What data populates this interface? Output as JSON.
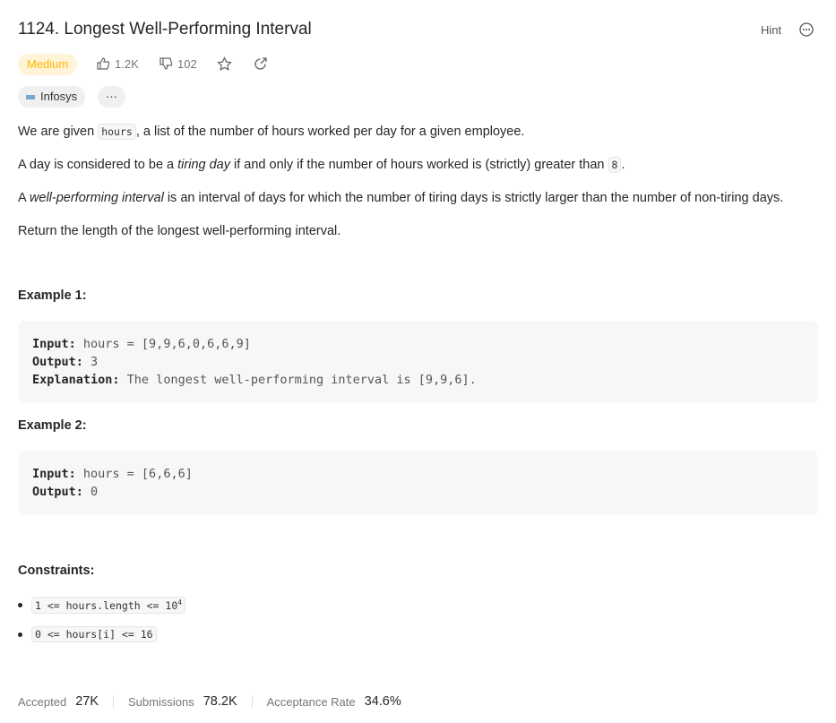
{
  "header": {
    "title": "1124. Longest Well-Performing Interval",
    "hint": "Hint"
  },
  "meta": {
    "difficulty": "Medium",
    "likes": "1.2K",
    "dislikes": "102",
    "company": "Infosys",
    "more": "···"
  },
  "desc": {
    "p1": [
      "We are given ",
      "hours",
      ", a list of the number of hours worked per day for a given employee."
    ],
    "p2": [
      "A day is considered to be a ",
      "tiring day",
      " if and only if the number of hours worked is (strictly) greater than ",
      "8",
      "."
    ],
    "p3": [
      "A ",
      "well-performing interval",
      " is an interval of days for which the number of tiring days is strictly larger than the number of non-tiring days."
    ],
    "p4": "Return the length of the longest well-performing interval."
  },
  "examples": [
    {
      "title": "Example 1:",
      "input_label": "Input:",
      "input": " hours = [9,9,6,0,6,6,9]",
      "output_label": "Output:",
      "output": " 3",
      "expl_label": "Explanation:",
      "expl": " The longest well-performing interval is [9,9,6]."
    },
    {
      "title": "Example 2:",
      "input_label": "Input:",
      "input": " hours = [6,6,6]",
      "output_label": "Output:",
      "output": " 0"
    }
  ],
  "constraints": {
    "title": "Constraints:",
    "c1": "1 <= hours.length <= 10",
    "c1_sup": "4",
    "c2": "0 <= hours[i] <= 16"
  },
  "footer": {
    "accepted_label": "Accepted",
    "accepted": "27K",
    "submissions_label": "Submissions",
    "submissions": "78.2K",
    "rate_label": "Acceptance Rate",
    "rate": "34.6%"
  }
}
